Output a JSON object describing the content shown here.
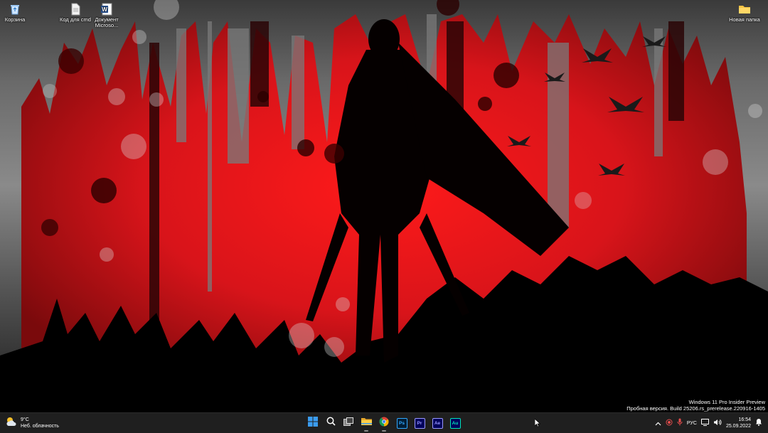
{
  "desktop": {
    "icons": [
      {
        "label": "Корзина",
        "icon": "recycle-bin-icon"
      },
      {
        "label": "Код для cmd",
        "icon": "text-file-icon"
      },
      {
        "label": "Документ Microsо...",
        "icon": "word-document-icon"
      },
      {
        "label": "Новая папка",
        "icon": "folder-icon"
      }
    ]
  },
  "watermark": {
    "line1": "Windows 11 Pro Insider Preview",
    "line2": "Пробная версия. Build 25206.rs_prerelease.220916-1405"
  },
  "taskbar": {
    "weather": {
      "temp": "9°C",
      "condition": "Неб. облачность",
      "icon": "partly-cloudy-icon"
    },
    "apps": [
      {
        "name": "start-button",
        "icon": "windows-logo-icon"
      },
      {
        "name": "search-button",
        "icon": "search-icon"
      },
      {
        "name": "task-view-button",
        "icon": "task-view-icon"
      },
      {
        "name": "file-explorer-button",
        "icon": "folder-icon"
      },
      {
        "name": "chrome-button",
        "icon": "chrome-icon"
      },
      {
        "name": "photoshop-button",
        "label": "Ps",
        "icon": "photoshop-icon"
      },
      {
        "name": "premiere-button",
        "label": "Pr",
        "icon": "premiere-icon"
      },
      {
        "name": "after-effects-button",
        "label": "Ae",
        "icon": "after-effects-icon"
      },
      {
        "name": "audition-button",
        "label": "Au",
        "icon": "audition-icon"
      }
    ],
    "tray": {
      "language": "РУС",
      "time": "16:54",
      "date": "25.09.2022"
    }
  },
  "colors": {
    "wallpaper_red": "#d8141a",
    "taskbar_bg": "#1f1f1f",
    "ps": "#31a8ff",
    "pr": "#9999ff",
    "ae": "#9999ff",
    "au": "#00e4bb"
  }
}
